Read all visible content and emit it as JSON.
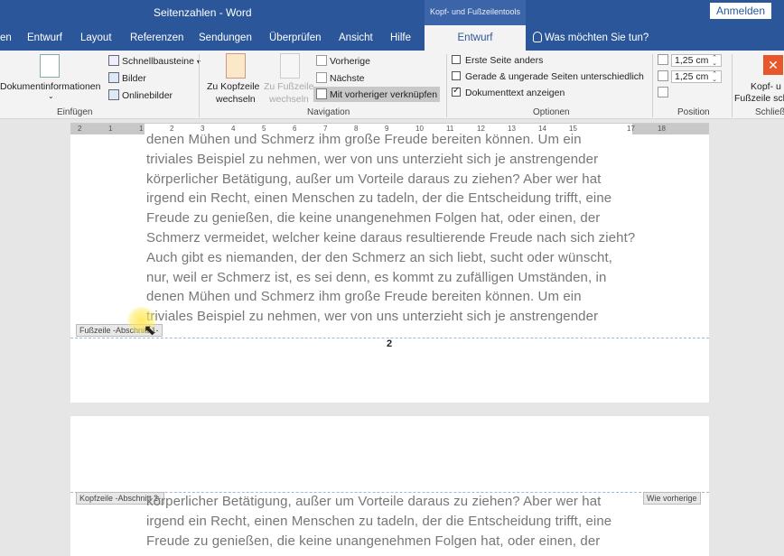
{
  "titlebar": {
    "title": "Seitenzahlen  -  Word",
    "context_title": "Kopf- und Fußzeilentools",
    "signin": "Anmelden"
  },
  "tabs": [
    {
      "label": "en"
    },
    {
      "label": "Entwurf"
    },
    {
      "label": "Layout"
    },
    {
      "label": "Referenzen"
    },
    {
      "label": "Sendungen"
    },
    {
      "label": "Überprüfen"
    },
    {
      "label": "Ansicht"
    },
    {
      "label": "Hilfe"
    },
    {
      "label": "Entwurf",
      "active": true
    }
  ],
  "tell_me": "Was möchten Sie tun?",
  "ribbon": {
    "insert": {
      "docinfo": "Dokumentinformationen",
      "quickparts": "Schnellbausteine",
      "pictures": "Bilder",
      "online_pictures": "Onlinebilder",
      "group": "Einfügen"
    },
    "navigation": {
      "goto_header_1": "Zu Kopfzeile",
      "goto_header_2": "wechseln",
      "goto_footer_1": "Zu Fußzeile",
      "goto_footer_2": "wechseln",
      "previous": "Vorherige",
      "next": "Nächste",
      "link_previous": "Mit vorheriger verknüpfen",
      "group": "Navigation"
    },
    "options": {
      "first_page": "Erste Seite anders",
      "odd_even": "Gerade & ungerade Seiten unterschiedlich",
      "show_doc_text": "Dokumenttext anzeigen",
      "first_page_checked": false,
      "odd_even_checked": false,
      "show_doc_text_checked": true,
      "group": "Optionen"
    },
    "position": {
      "header_distance": "1,25 cm",
      "footer_distance": "1,25 cm",
      "group": "Position"
    },
    "close": {
      "label_1": "Kopf- u",
      "label_2": "Fußzeile sch",
      "group": "Schließe"
    }
  },
  "ruler": {
    "labels": [
      "2",
      "1",
      "1",
      "2",
      "3",
      "4",
      "5",
      "6",
      "7",
      "8",
      "9",
      "10",
      "11",
      "12",
      "13",
      "14",
      "15",
      "17",
      "18"
    ]
  },
  "page1": {
    "lines": [
      "denen Mühen und Schmerz ihm große Freude bereiten können. Um ein",
      "triviales Beispiel zu nehmen, wer von uns unterzieht sich je anstrengender",
      "körperlicher Betätigung, außer um Vorteile daraus zu ziehen? Aber wer hat",
      "irgend ein Recht, einen Menschen zu tadeln, der die Entscheidung trifft, eine",
      "Freude zu genießen, die keine unangenehmen Folgen hat, oder einen, der",
      "Schmerz vermeidet, welcher keine daraus resultierende Freude nach sich zieht?",
      "Auch gibt es niemanden, der den Schmerz an sich liebt, sucht oder wünscht,",
      "nur, weil er Schmerz ist, es sei denn, es kommt zu zufälligen Umständen, in",
      "denen Mühen und Schmerz ihm große Freude bereiten können. Um ein",
      "triviales Beispiel zu nehmen, wer von uns unterzieht sich je anstrengender"
    ],
    "footer_tag": "Fußzeile -Abschnitt 1-",
    "page_number": "2"
  },
  "page2": {
    "header_tag": "Kopfzeile -Abschnitt 2-",
    "same_as_previous": "Wie vorherige",
    "lines": [
      "körperlicher Betätigung, außer um Vorteile daraus zu ziehen? Aber wer hat",
      "irgend ein Recht, einen Menschen zu tadeln, der die Entscheidung trifft, eine",
      "Freude zu genießen, die keine unangenehmen Folgen hat, oder einen, der"
    ]
  },
  "colors": {
    "accent": "#2b579a",
    "ribbon_bg": "#f3f3f3",
    "workspace": "#e6e6e6"
  }
}
